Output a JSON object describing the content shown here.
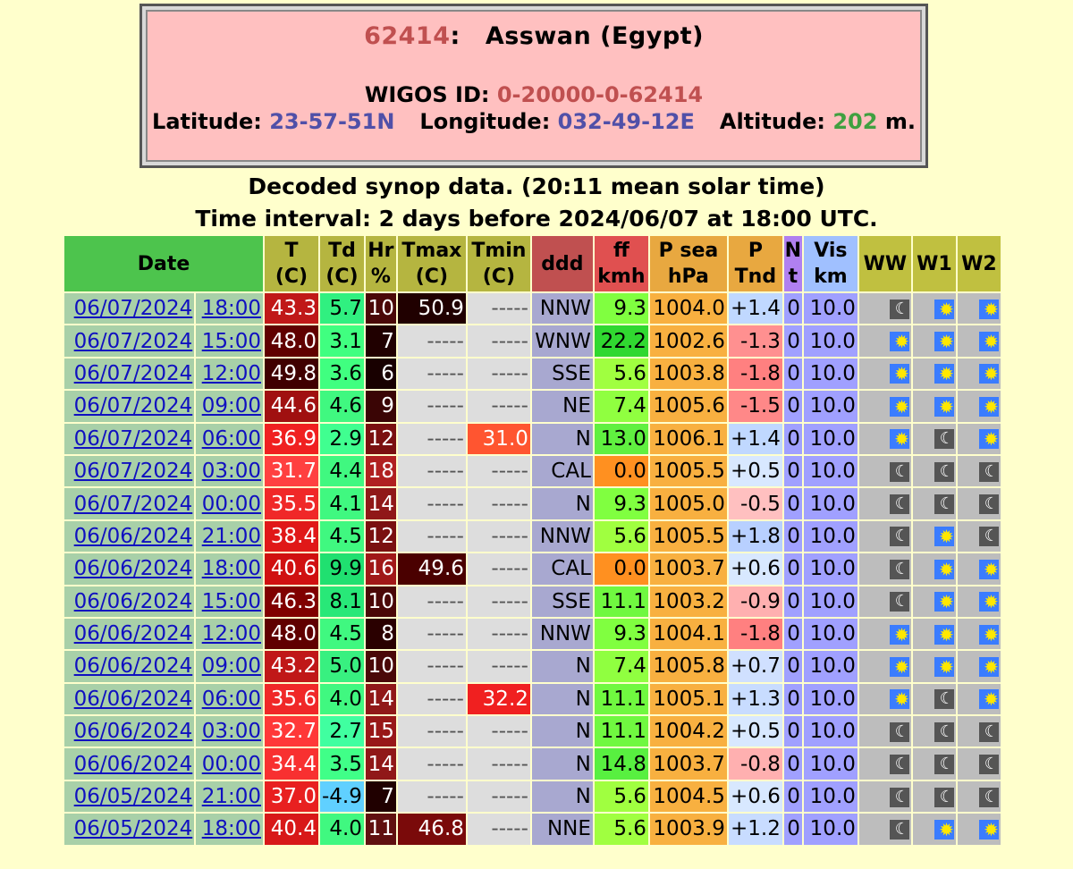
{
  "station": {
    "id": "62414",
    "name": "Asswan (Egypt)",
    "wigos_label": "WIGOS ID:",
    "wigos_id": "0-20000-0-62414",
    "lat_label": "Latitude:",
    "lat": "23-57-51N",
    "lon_label": "Longitude:",
    "lon": "032-49-12E",
    "alt_label": "Altitude:",
    "alt": "202",
    "alt_unit": "m."
  },
  "title1": "Decoded synop data. (20:11 mean solar time)",
  "title2": "Time interval: 2 days before 2024/06/07 at 18:00 UTC.",
  "headers": {
    "date": "Date",
    "t1": "T",
    "t2": "(C)",
    "td1": "Td",
    "td2": "(C)",
    "hr1": "Hr",
    "hr2": "%",
    "tmax1": "Tmax",
    "tmax2": "(C)",
    "tmin1": "Tmin",
    "tmin2": "(C)",
    "ddd": "ddd",
    "ff1": "ff",
    "ff2": "kmh",
    "psea1": "P sea",
    "psea2": "hPa",
    "ptnd1": "P",
    "ptnd2": "Tnd",
    "n1": "N",
    "n2": "t",
    "vis1": "Vis",
    "vis2": "km",
    "ww": "WW",
    "w1": "W1",
    "w2": "W2"
  },
  "colors": {
    "header_date": "#4dc44d",
    "header_temp": "#b5b540",
    "header_ddd": "#c05050",
    "header_ff": "#e05050",
    "header_psea": "#e8a840",
    "header_n": "#b080f0",
    "header_vis": "#a0c0ff",
    "header_weather": "#c0c040",
    "page_background": "#ffffcc",
    "station_box": "#ffc0c0"
  },
  "weather_icons": {
    "moon": "moon-icon",
    "sun": "sun-icon"
  },
  "rows": [
    {
      "date": "06/07/2024",
      "time": "18:00",
      "t": "43.3",
      "t_bg": "#c01818",
      "td": "5.7",
      "td_bg": "#30f080",
      "hr": "10",
      "hr_bg": "#4a0808",
      "tmax": "50.9",
      "tmax_bg": "#200000",
      "tmin": "-----",
      "tmin_bg": "",
      "ddd": "NNW",
      "ff": "9.3",
      "ff_bg": "#80ff40",
      "psea": "1004.0",
      "ptnd": "+1.4",
      "ptnd_bg": "#c0d8ff",
      "n": "0",
      "vis": "10.0",
      "ww": "moon",
      "w1": "sun",
      "w2": "sun"
    },
    {
      "date": "06/07/2024",
      "time": "15:00",
      "t": "48.0",
      "t_bg": "#600000",
      "td": "3.1",
      "td_bg": "#40ff80",
      "hr": "7",
      "hr_bg": "#200000",
      "tmax": "-----",
      "tmax_bg": "",
      "tmin": "-----",
      "tmin_bg": "",
      "ddd": "WNW",
      "ff": "22.2",
      "ff_bg": "#30d830",
      "psea": "1002.6",
      "ptnd": "-1.3",
      "ptnd_bg": "#ff9090",
      "n": "0",
      "vis": "10.0",
      "ww": "sun",
      "w1": "sun",
      "w2": "sun"
    },
    {
      "date": "06/07/2024",
      "time": "12:00",
      "t": "49.8",
      "t_bg": "#400000",
      "td": "3.6",
      "td_bg": "#40ff80",
      "hr": "6",
      "hr_bg": "#180000",
      "tmax": "-----",
      "tmax_bg": "",
      "tmin": "-----",
      "tmin_bg": "",
      "ddd": "SSE",
      "ff": "5.6",
      "ff_bg": "#a0ff40",
      "psea": "1003.8",
      "ptnd": "-1.8",
      "ptnd_bg": "#ff8080",
      "n": "0",
      "vis": "10.0",
      "ww": "sun",
      "w1": "sun",
      "w2": "sun"
    },
    {
      "date": "06/07/2024",
      "time": "09:00",
      "t": "44.6",
      "t_bg": "#a01010",
      "td": "4.6",
      "td_bg": "#40f880",
      "hr": "9",
      "hr_bg": "#3a0505",
      "tmax": "-----",
      "tmax_bg": "",
      "tmin": "-----",
      "tmin_bg": "",
      "ddd": "NE",
      "ff": "7.4",
      "ff_bg": "#90ff40",
      "psea": "1005.6",
      "ptnd": "-1.5",
      "ptnd_bg": "#ff8888",
      "n": "0",
      "vis": "10.0",
      "ww": "sun",
      "w1": "sun",
      "w2": "sun"
    },
    {
      "date": "06/07/2024",
      "time": "06:00",
      "t": "36.9",
      "t_bg": "#f02020",
      "td": "2.9",
      "td_bg": "#40ff90",
      "hr": "12",
      "hr_bg": "#7a1010",
      "tmax": "-----",
      "tmax_bg": "",
      "tmin": "31.0",
      "tmin_bg": "#ff5530",
      "ddd": "N",
      "ff": "13.0",
      "ff_bg": "#60f040",
      "psea": "1006.1",
      "ptnd": "+1.4",
      "ptnd_bg": "#c0d8ff",
      "n": "0",
      "vis": "10.0",
      "ww": "sun",
      "w1": "moon",
      "w2": "sun"
    },
    {
      "date": "06/07/2024",
      "time": "03:00",
      "t": "31.7",
      "t_bg": "#ff4040",
      "td": "4.4",
      "td_bg": "#40f880",
      "hr": "18",
      "hr_bg": "#b02020",
      "tmax": "-----",
      "tmax_bg": "",
      "tmin": "-----",
      "tmin_bg": "",
      "ddd": "CAL",
      "ff": "0.0",
      "ff_bg": "#ff9020",
      "psea": "1005.5",
      "ptnd": "+0.5",
      "ptnd_bg": "#d8e8ff",
      "n": "0",
      "vis": "10.0",
      "ww": "moon",
      "w1": "moon",
      "w2": "moon"
    },
    {
      "date": "06/07/2024",
      "time": "00:00",
      "t": "35.5",
      "t_bg": "#f02828",
      "td": "4.1",
      "td_bg": "#40f880",
      "hr": "14",
      "hr_bg": "#901818",
      "tmax": "-----",
      "tmax_bg": "",
      "tmin": "-----",
      "tmin_bg": "",
      "ddd": "N",
      "ff": "9.3",
      "ff_bg": "#80ff40",
      "psea": "1005.0",
      "ptnd": "-0.5",
      "ptnd_bg": "#ffc0c0",
      "n": "0",
      "vis": "10.0",
      "ww": "moon",
      "w1": "moon",
      "w2": "moon"
    },
    {
      "date": "06/06/2024",
      "time": "21:00",
      "t": "38.4",
      "t_bg": "#e01818",
      "td": "4.5",
      "td_bg": "#40f880",
      "hr": "12",
      "hr_bg": "#7a1010",
      "tmax": "-----",
      "tmax_bg": "",
      "tmin": "-----",
      "tmin_bg": "",
      "ddd": "NNW",
      "ff": "5.6",
      "ff_bg": "#a0ff40",
      "psea": "1005.5",
      "ptnd": "+1.8",
      "ptnd_bg": "#b8d0ff",
      "n": "0",
      "vis": "10.0",
      "ww": "moon",
      "w1": "sun",
      "w2": "moon"
    },
    {
      "date": "06/06/2024",
      "time": "18:00",
      "t": "40.6",
      "t_bg": "#d01010",
      "td": "9.9",
      "td_bg": "#20e070",
      "hr": "16",
      "hr_bg": "#a01818",
      "tmax": "49.6",
      "tmax_bg": "#4a0000",
      "tmin": "-----",
      "tmin_bg": "",
      "ddd": "CAL",
      "ff": "0.0",
      "ff_bg": "#ff9020",
      "psea": "1003.7",
      "ptnd": "+0.6",
      "ptnd_bg": "#d8e8ff",
      "n": "0",
      "vis": "10.0",
      "ww": "moon",
      "w1": "sun",
      "w2": "sun"
    },
    {
      "date": "06/06/2024",
      "time": "15:00",
      "t": "46.3",
      "t_bg": "#800000",
      "td": "8.1",
      "td_bg": "#28e878",
      "hr": "10",
      "hr_bg": "#4a0808",
      "tmax": "-----",
      "tmax_bg": "",
      "tmin": "-----",
      "tmin_bg": "",
      "ddd": "SSE",
      "ff": "11.1",
      "ff_bg": "#70f840",
      "psea": "1003.2",
      "ptnd": "-0.9",
      "ptnd_bg": "#ffb0b0",
      "n": "0",
      "vis": "10.0",
      "ww": "moon",
      "w1": "sun",
      "w2": "sun"
    },
    {
      "date": "06/06/2024",
      "time": "12:00",
      "t": "48.0",
      "t_bg": "#600000",
      "td": "4.5",
      "td_bg": "#40f880",
      "hr": "8",
      "hr_bg": "#2a0000",
      "tmax": "-----",
      "tmax_bg": "",
      "tmin": "-----",
      "tmin_bg": "",
      "ddd": "NNW",
      "ff": "9.3",
      "ff_bg": "#80ff40",
      "psea": "1004.1",
      "ptnd": "-1.8",
      "ptnd_bg": "#ff8080",
      "n": "0",
      "vis": "10.0",
      "ww": "sun",
      "w1": "sun",
      "w2": "sun"
    },
    {
      "date": "06/06/2024",
      "time": "09:00",
      "t": "43.2",
      "t_bg": "#c01818",
      "td": "5.0",
      "td_bg": "#38f080",
      "hr": "10",
      "hr_bg": "#4a0808",
      "tmax": "-----",
      "tmax_bg": "",
      "tmin": "-----",
      "tmin_bg": "",
      "ddd": "N",
      "ff": "7.4",
      "ff_bg": "#90ff40",
      "psea": "1005.8",
      "ptnd": "+0.7",
      "ptnd_bg": "#d0e0ff",
      "n": "0",
      "vis": "10.0",
      "ww": "sun",
      "w1": "sun",
      "w2": "sun"
    },
    {
      "date": "06/06/2024",
      "time": "06:00",
      "t": "35.6",
      "t_bg": "#f02828",
      "td": "4.0",
      "td_bg": "#40f880",
      "hr": "14",
      "hr_bg": "#901818",
      "tmax": "-----",
      "tmax_bg": "",
      "tmin": "32.2",
      "tmin_bg": "#f02020",
      "ddd": "N",
      "ff": "11.1",
      "ff_bg": "#70f840",
      "psea": "1005.1",
      "ptnd": "+1.3",
      "ptnd_bg": "#c8dcff",
      "n": "0",
      "vis": "10.0",
      "ww": "sun",
      "w1": "moon",
      "w2": "sun"
    },
    {
      "date": "06/06/2024",
      "time": "03:00",
      "t": "32.7",
      "t_bg": "#ff3838",
      "td": "2.7",
      "td_bg": "#40ffa0",
      "hr": "15",
      "hr_bg": "#981818",
      "tmax": "-----",
      "tmax_bg": "",
      "tmin": "-----",
      "tmin_bg": "",
      "ddd": "N",
      "ff": "11.1",
      "ff_bg": "#70f840",
      "psea": "1004.2",
      "ptnd": "+0.5",
      "ptnd_bg": "#d8e8ff",
      "n": "0",
      "vis": "10.0",
      "ww": "moon",
      "w1": "moon",
      "w2": "moon"
    },
    {
      "date": "06/06/2024",
      "time": "00:00",
      "t": "34.4",
      "t_bg": "#f83030",
      "td": "3.5",
      "td_bg": "#40ff88",
      "hr": "14",
      "hr_bg": "#901818",
      "tmax": "-----",
      "tmax_bg": "",
      "tmin": "-----",
      "tmin_bg": "",
      "ddd": "N",
      "ff": "14.8",
      "ff_bg": "#58f040",
      "psea": "1003.7",
      "ptnd": "-0.8",
      "ptnd_bg": "#ffb0b0",
      "n": "0",
      "vis": "10.0",
      "ww": "moon",
      "w1": "moon",
      "w2": "moon"
    },
    {
      "date": "06/05/2024",
      "time": "21:00",
      "t": "37.0",
      "t_bg": "#e82020",
      "td": "-4.9",
      "td_bg": "#60d0ff",
      "hr": "7",
      "hr_bg": "#200000",
      "tmax": "-----",
      "tmax_bg": "",
      "tmin": "-----",
      "tmin_bg": "",
      "ddd": "N",
      "ff": "5.6",
      "ff_bg": "#a0ff40",
      "psea": "1004.5",
      "ptnd": "+0.6",
      "ptnd_bg": "#d8e8ff",
      "n": "0",
      "vis": "10.0",
      "ww": "moon",
      "w1": "moon",
      "w2": "moon"
    },
    {
      "date": "06/05/2024",
      "time": "18:00",
      "t": "40.4",
      "t_bg": "#d81818",
      "td": "4.0",
      "td_bg": "#40f880",
      "hr": "11",
      "hr_bg": "#601010",
      "tmax": "46.8",
      "tmax_bg": "#7a0a0a",
      "tmin": "-----",
      "tmin_bg": "",
      "ddd": "NNE",
      "ff": "5.6",
      "ff_bg": "#a0ff40",
      "psea": "1003.9",
      "ptnd": "+1.2",
      "ptnd_bg": "#c8dcff",
      "n": "0",
      "vis": "10.0",
      "ww": "moon",
      "w1": "sun",
      "w2": "sun"
    }
  ]
}
